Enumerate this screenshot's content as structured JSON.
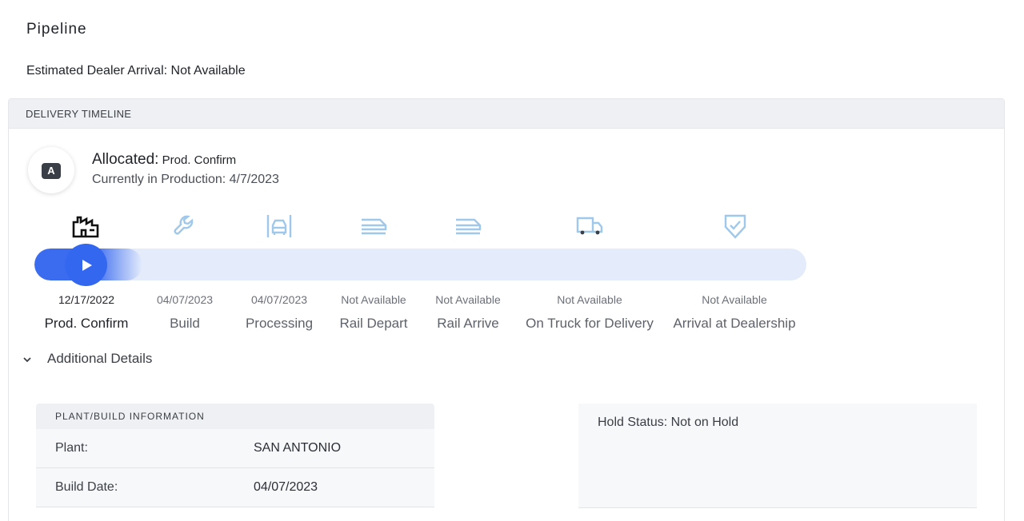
{
  "page": {
    "title": "Pipeline",
    "eta": "Estimated Dealer Arrival: Not Available"
  },
  "timeline": {
    "header": "DELIVERY TIMELINE",
    "avatar_letter": "A",
    "status_label": "Allocated:",
    "status_value": "Prod. Confirm",
    "status_sub": "Currently in Production: 4/7/2023",
    "progress_fraction": 0.1,
    "colors": {
      "active": "#3467ef",
      "inactive_icon": "#9fc8ea",
      "track": "#e4ebfb"
    },
    "steps": [
      {
        "icon": "factory-icon",
        "date": "12/17/2022",
        "name": "Prod. Confirm",
        "active": true
      },
      {
        "icon": "wrench-icon",
        "date": "04/07/2023",
        "name": "Build",
        "active": false
      },
      {
        "icon": "car-processing-icon",
        "date": "04/07/2023",
        "name": "Processing",
        "active": false
      },
      {
        "icon": "rail-depart-icon",
        "date": "Not Available",
        "name": "Rail Depart",
        "active": false
      },
      {
        "icon": "rail-arrive-icon",
        "date": "Not Available",
        "name": "Rail Arrive",
        "active": false
      },
      {
        "icon": "truck-icon",
        "date": "Not Available",
        "name": "On Truck for Delivery",
        "active": false
      },
      {
        "icon": "shield-check-icon",
        "date": "Not Available",
        "name": "Arrival at Dealership",
        "active": false
      }
    ]
  },
  "details": {
    "toggle_label": "Additional Details",
    "plant": {
      "header": "PLANT/BUILD INFORMATION",
      "rows": [
        {
          "key": "Plant:",
          "value": "SAN ANTONIO"
        },
        {
          "key": "Build Date:",
          "value": "04/07/2023"
        }
      ]
    },
    "hold_status": "Hold Status: Not on Hold"
  }
}
